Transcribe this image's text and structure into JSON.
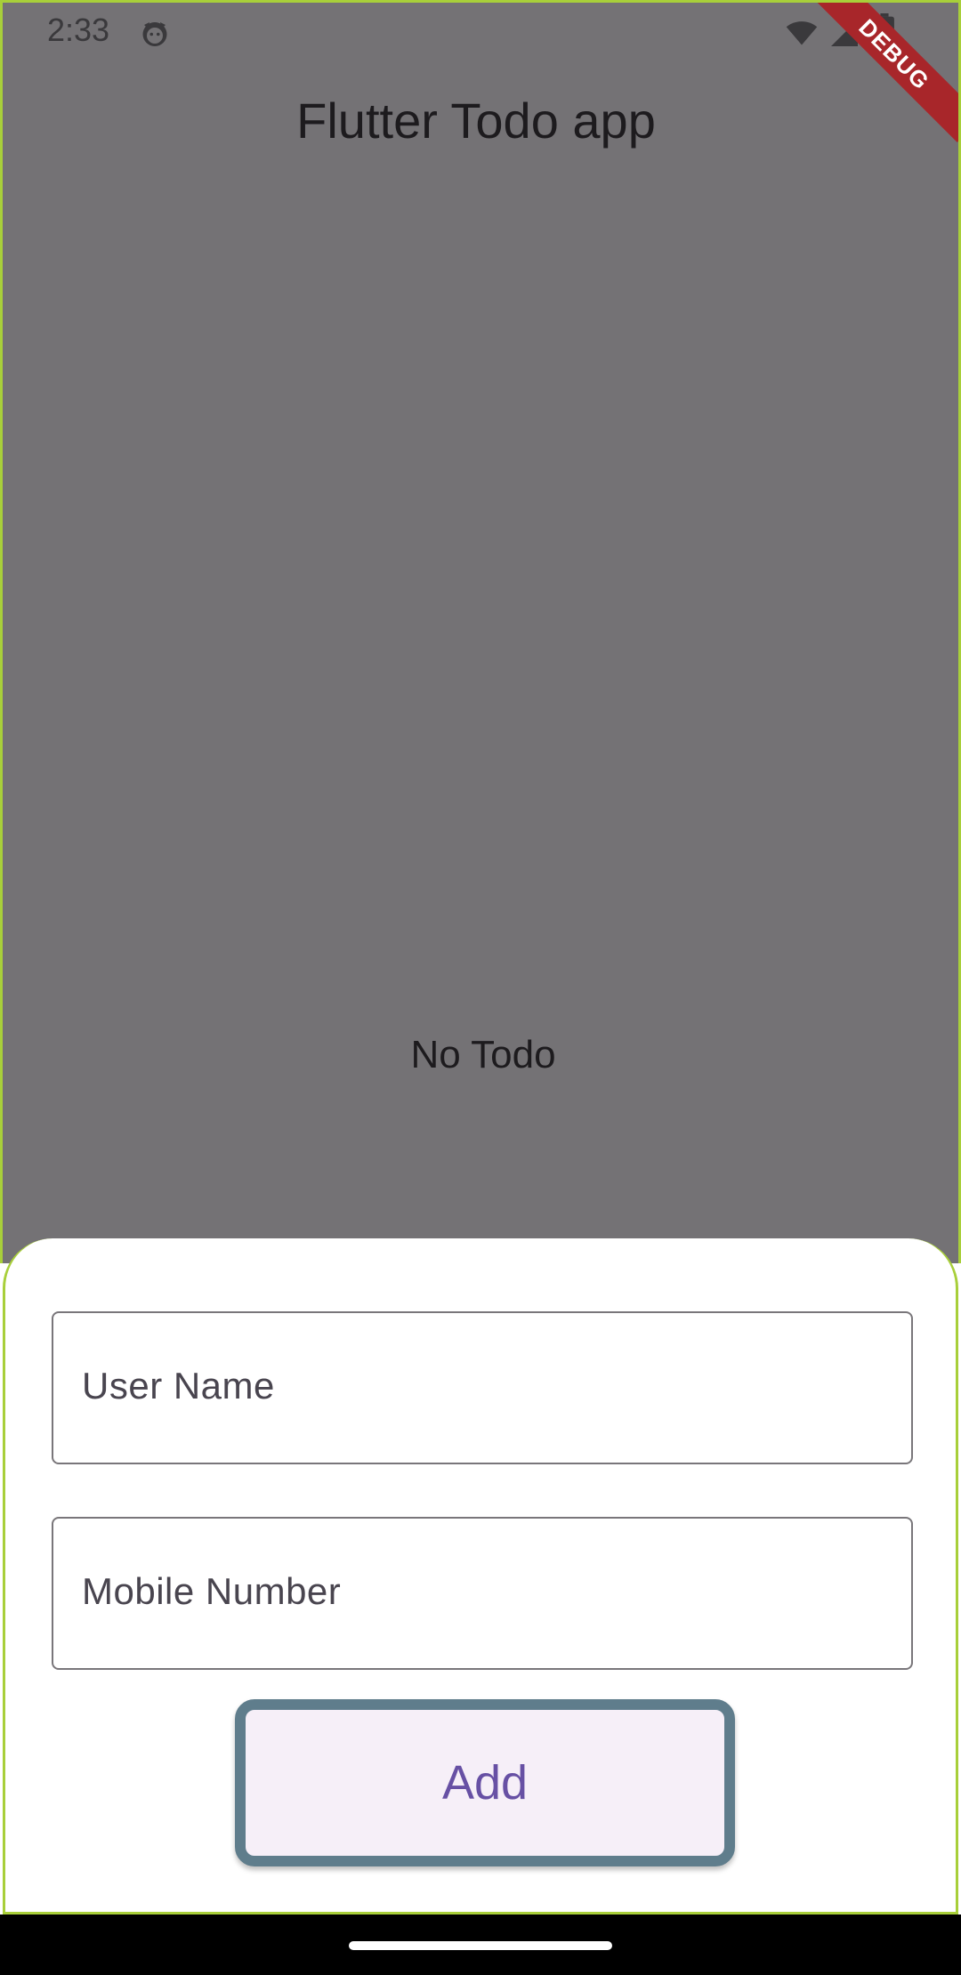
{
  "status_bar": {
    "time": "2:33",
    "icons": [
      "cat-icon",
      "wifi-icon",
      "signal-icon",
      "battery-icon"
    ]
  },
  "debug_banner": "DEBUG",
  "app_bar": {
    "title": "Flutter Todo app"
  },
  "todo_list": {
    "empty_message": "No Todo"
  },
  "bottom_sheet": {
    "user_name_field": {
      "label": "User Name",
      "value": ""
    },
    "mobile_number_field": {
      "label": "Mobile Number",
      "value": ""
    },
    "add_button_label": "Add"
  },
  "colors": {
    "scrim": "#747275",
    "sheet": "#ffffff",
    "button_bg": "#f6eff8",
    "button_border": "#5f7d8c",
    "button_text": "#6750a4",
    "debug_ribbon": "#a8262a"
  }
}
